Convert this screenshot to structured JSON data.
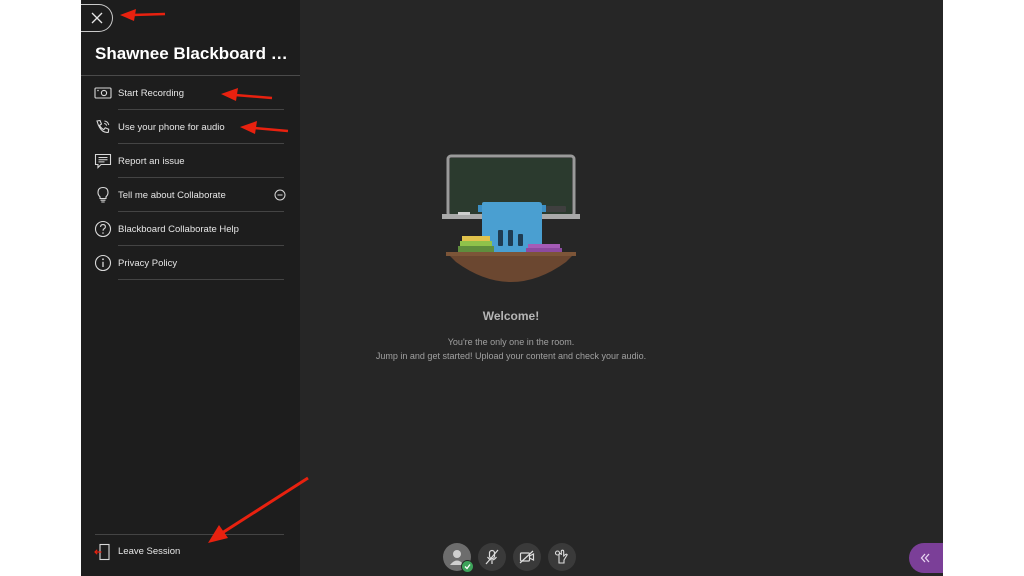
{
  "session": {
    "title": "Shawnee Blackboard U..."
  },
  "menu": {
    "items": [
      {
        "label": "Start Recording",
        "icon": "record-icon"
      },
      {
        "label": "Use your phone for audio",
        "icon": "phone-icon"
      },
      {
        "label": "Report an issue",
        "icon": "report-icon"
      },
      {
        "label": "Tell me about Collaborate",
        "icon": "lightbulb-icon"
      },
      {
        "label": "Blackboard Collaborate Help",
        "icon": "help-icon"
      },
      {
        "label": "Privacy Policy",
        "icon": "info-icon"
      }
    ],
    "leave_label": "Leave Session"
  },
  "welcome": {
    "title": "Welcome!",
    "line1": "You're the only one in the room.",
    "line2": "Jump in and get started! Upload your content and check your audio."
  },
  "colors": {
    "accent_purple": "#7b3f98",
    "status_green": "#3da35a",
    "annotation_red": "#e8210f"
  }
}
